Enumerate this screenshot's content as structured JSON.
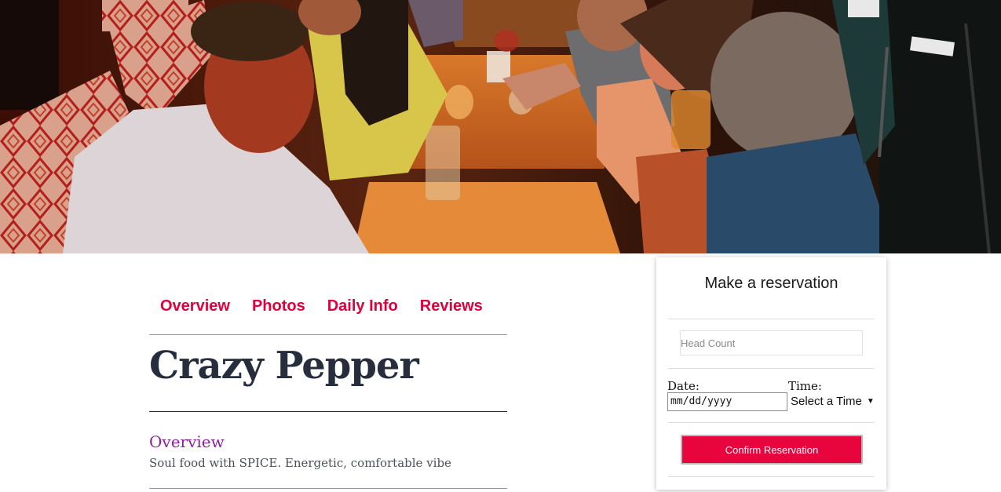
{
  "hero": {
    "image": "restaurant-photo",
    "description_icon": "dining-scene-image"
  },
  "tabs": [
    {
      "label": "Overview"
    },
    {
      "label": "Photos"
    },
    {
      "label": "Daily Info"
    },
    {
      "label": "Reviews"
    }
  ],
  "restaurant": {
    "name": "Crazy Pepper",
    "overview_heading": "Overview",
    "overview_text": "Soul food with SPICE. Energetic, comfortable vibe"
  },
  "reservation": {
    "title": "Make a reservation",
    "head_count_placeholder": "Head Count",
    "date_label": "Date:",
    "date_value": "mm/dd/yyyy",
    "time_label": "Time:",
    "time_value": "Select a Time",
    "confirm_label": "Confirm Reservation"
  },
  "colors": {
    "accent": "#e0003c",
    "title": "#262d3d",
    "section_heading": "#8b1e9c"
  }
}
